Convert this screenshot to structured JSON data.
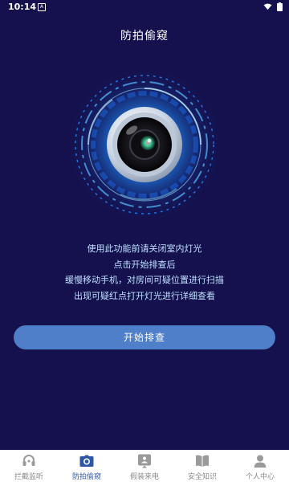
{
  "status_bar": {
    "time": "10:14",
    "badge": "A"
  },
  "header": {
    "title": "防拍偷窥"
  },
  "instructions": {
    "lines": [
      "使用此功能前请关闭室内灯光",
      "点击开始排查后",
      "缓慢移动手机，对房间可疑位置进行扫描",
      "出现可疑红点打开灯光进行详细查看"
    ]
  },
  "start_button": {
    "label": "开始排查"
  },
  "tabs": [
    {
      "label": "拦截监听",
      "icon": "headset-icon"
    },
    {
      "label": "防拍偷窥",
      "icon": "camera-icon",
      "active": true
    },
    {
      "label": "假装来电",
      "icon": "phone-card-icon"
    },
    {
      "label": "安全知识",
      "icon": "book-icon"
    },
    {
      "label": "个人中心",
      "icon": "person-icon"
    }
  ],
  "colors": {
    "background": "#15114e",
    "accent": "#4f7fc9",
    "active_tab": "#2e56a8",
    "inactive_tab": "#8a8a8a"
  }
}
